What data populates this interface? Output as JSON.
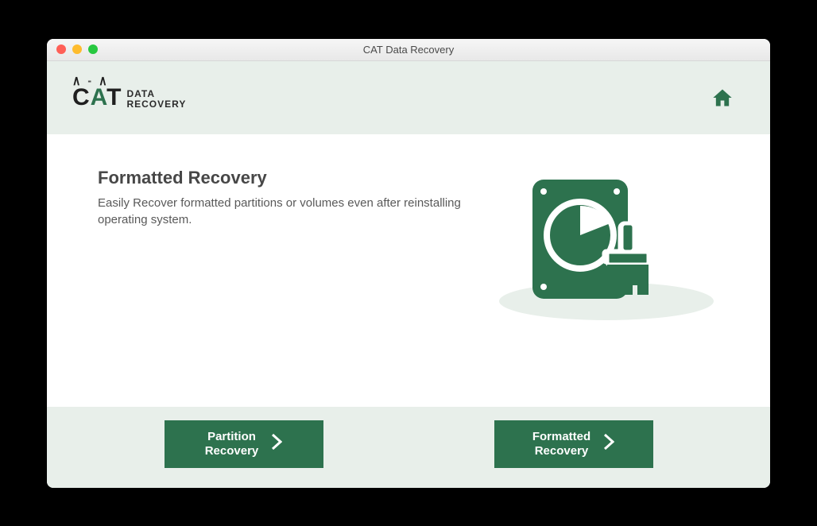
{
  "window": {
    "title": "CAT Data Recovery"
  },
  "logo": {
    "word": "CAT",
    "line1": "DATA",
    "line2": "RECOVERY"
  },
  "main": {
    "heading": "Formatted Recovery",
    "description": "Easily Recover formatted partitions or volumes even after reinstalling operating system."
  },
  "buttons": {
    "partition": {
      "line1": "Partition",
      "line2": "Recovery"
    },
    "formatted": {
      "line1": "Formatted",
      "line2": "Recovery"
    }
  },
  "colors": {
    "accent": "#2d724e",
    "panel": "#e8efea"
  }
}
